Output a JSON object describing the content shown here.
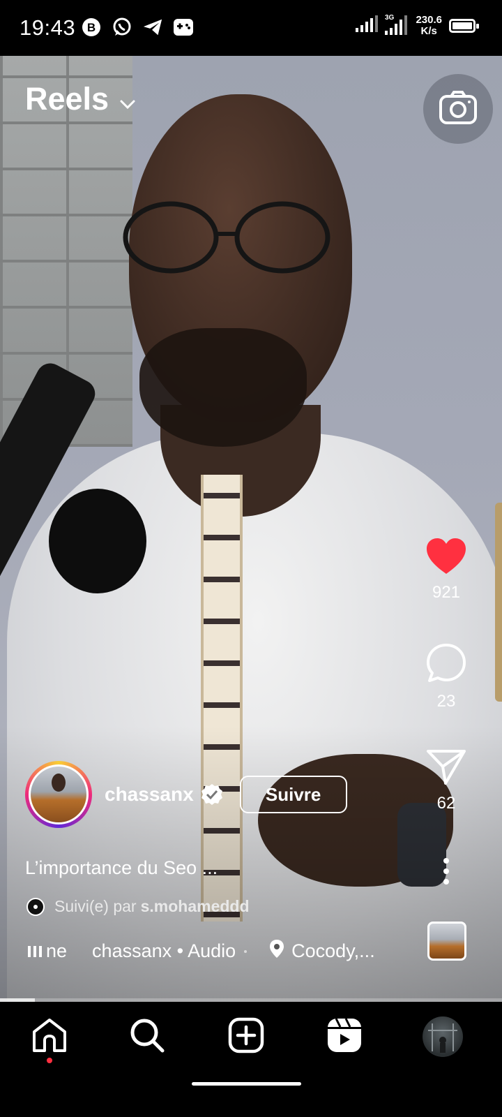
{
  "status_bar": {
    "time": "19:43",
    "net_speed_value": "230.6",
    "net_speed_unit": "K/s",
    "left_icons": [
      "b-app-icon",
      "whatsapp-icon",
      "telegram-icon",
      "game-controller-icon"
    ],
    "battery_level": 1.0
  },
  "header": {
    "title": "Reels"
  },
  "actions": {
    "likes": "921",
    "comments": "23",
    "shares": "62",
    "like_color": "#ff3040"
  },
  "author": {
    "username": "chassanx",
    "verified": true,
    "follow_label": "Suivre"
  },
  "caption": "L’importance du Seo ...",
  "followed_by": {
    "prefix": "Suivi(e) par",
    "user": "s.mohameddd"
  },
  "audio": {
    "partial_label": "ne",
    "track": "chassanx • Audio",
    "location": "Cocody,..."
  },
  "progress": 0.07,
  "colors": {
    "background": "#000000",
    "text": "#ffffff",
    "accent": "#ff3040"
  }
}
